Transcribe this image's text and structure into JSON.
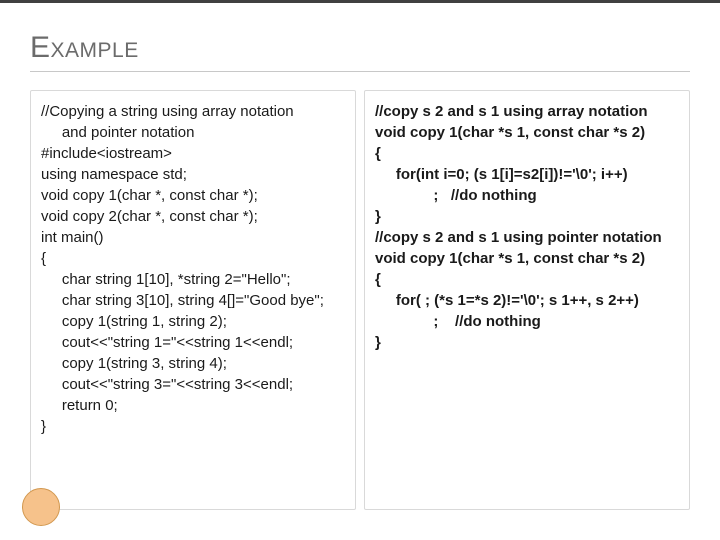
{
  "title": "Example",
  "left_code": "//Copying a string using array notation\n     and pointer notation\n#include<iostream>\nusing namespace std;\nvoid copy 1(char *, const char *);\nvoid copy 2(char *, const char *);\nint main()\n{\n     char string 1[10], *string 2=\"Hello\";\n     char string 3[10], string 4[]=\"Good bye\";\n     copy 1(string 1, string 2);\n     cout<<\"string 1=\"<<string 1<<endl;\n     copy 1(string 3, string 4);\n     cout<<\"string 3=\"<<string 3<<endl;\n     return 0;\n}",
  "right_code": "//copy s 2 and s 1 using array notation\nvoid copy 1(char *s 1, const char *s 2)\n{\n     for(int i=0; (s 1[i]=s2[i])!='\\0'; i++)\n              ;   //do nothing\n}\n//copy s 2 and s 1 using pointer notation\nvoid copy 1(char *s 1, const char *s 2)\n{\n     for( ; (*s 1=*s 2)!='\\0'; s 1++, s 2++)\n              ;    //do nothing\n}"
}
